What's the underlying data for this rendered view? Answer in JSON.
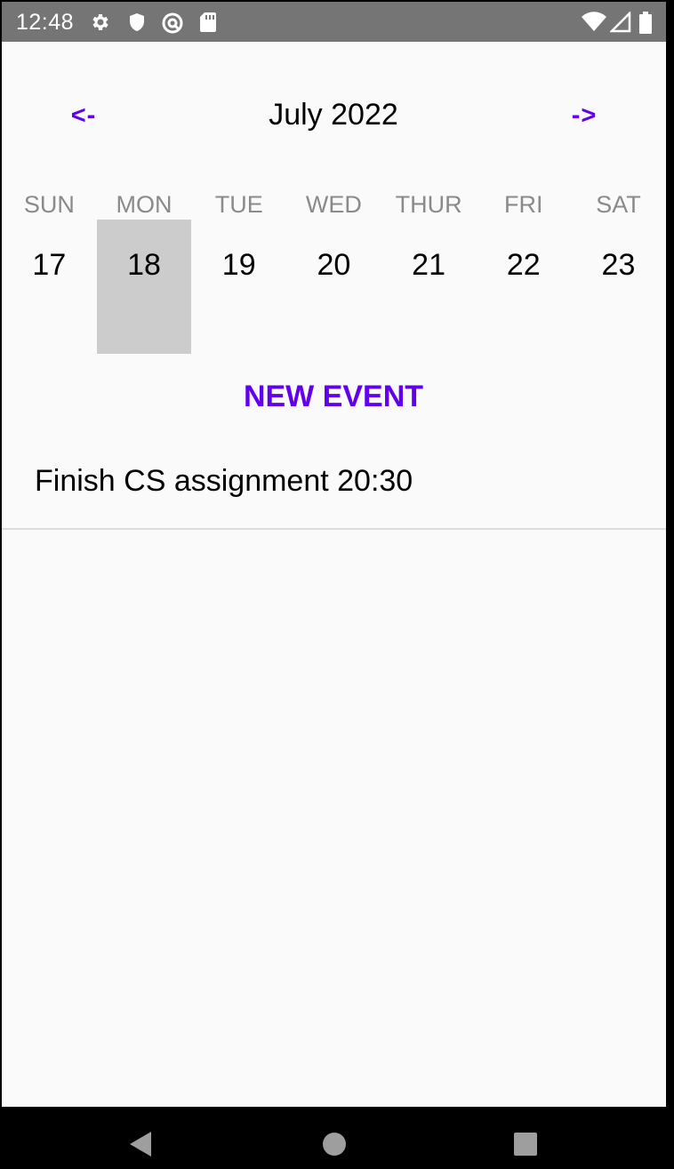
{
  "status_bar": {
    "time": "12:48",
    "left_icons": [
      "gear-icon",
      "shield-icon",
      "data-saver-icon",
      "sd-card-icon"
    ],
    "right_icons": [
      "wifi-icon",
      "cell-signal-icon",
      "battery-icon"
    ]
  },
  "calendar": {
    "prev_label": "<-",
    "next_label": "->",
    "month_title": "July 2022",
    "weekdays": [
      "SUN",
      "MON",
      "TUE",
      "WED",
      "THUR",
      "FRI",
      "SAT"
    ],
    "dates": [
      "17",
      "18",
      "19",
      "20",
      "21",
      "22",
      "23"
    ],
    "selected_date": "18"
  },
  "new_event_label": "NEW EVENT",
  "events": [
    {
      "text": "Finish CS assignment 20:30"
    }
  ],
  "colors": {
    "accent": "#6200ee",
    "status_bar": "#757575",
    "selected_cell": "#cccccc",
    "weekday_text": "#8a8a8a"
  },
  "system_nav": [
    "back-icon",
    "home-icon",
    "recents-icon"
  ]
}
